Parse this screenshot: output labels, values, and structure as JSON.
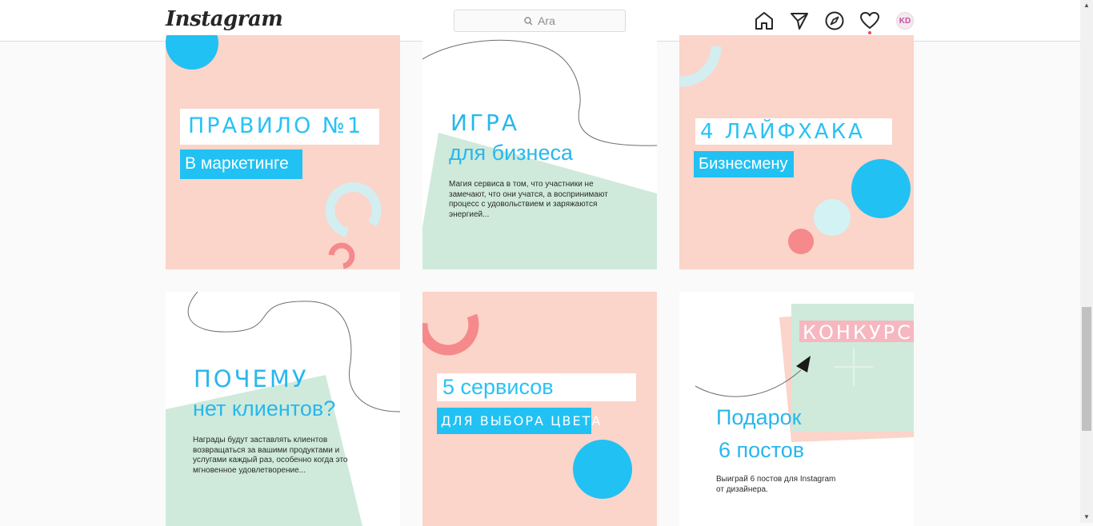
{
  "header": {
    "logo": "Instagram",
    "search_placeholder": "Ara",
    "avatar_initials": "KD"
  },
  "posts": [
    {
      "title": "ПРАВИЛО №1",
      "subtitle": "В маркетинге"
    },
    {
      "title": "ИГРА",
      "subtitle": "для бизнеса",
      "body": "Магия сервиса в том, что участники не замечают, что они учатся, а воспринимают процесс с удовольствием и заряжаются энергией..."
    },
    {
      "title": "4 ЛАЙФХАКА",
      "subtitle": "Бизнесмену"
    },
    {
      "title": "ПОЧЕМУ",
      "subtitle": "нет клиентов?",
      "body": "Награды будут заставлять клиентов возвращаться за вашими продуктами и услугами каждый раз, особенно когда это мгновенное удовлетворение..."
    },
    {
      "title": "5 сервисов",
      "subtitle": "ДЛЯ ВЫБОРА ЦВЕТА"
    },
    {
      "title": "КОНКУРС",
      "subtitle_line1": "Подарок",
      "subtitle_line2": "6 постов",
      "body": "Выиграй 6 постов для Instagram от дизайнера."
    }
  ],
  "colors": {
    "pink": "#fbd4ca",
    "blue": "#21c1f3",
    "mint": "#cfeadb",
    "coral": "#f6898b",
    "light_teal": "#d3eef0"
  }
}
